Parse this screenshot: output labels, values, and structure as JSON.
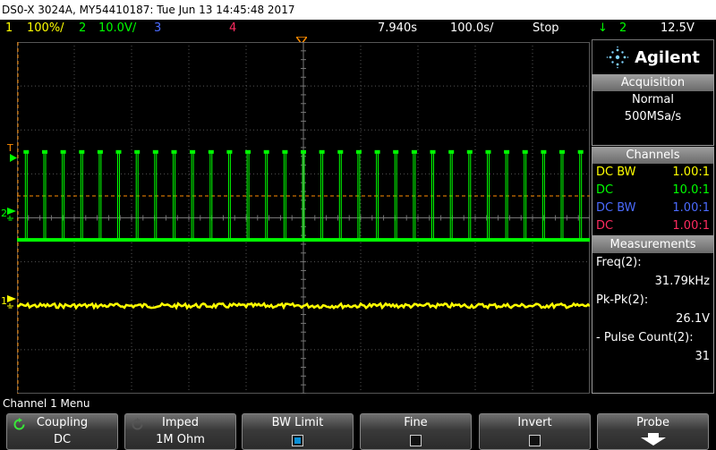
{
  "title_bar": {
    "text": "DS0-X 3024A, MY54410187: Tue Jun 13 14:45:48 2017"
  },
  "status_bar": {
    "ch1_num": "1",
    "ch1_scale": "100%/",
    "ch2_num": "2",
    "ch2_scale": "10.0V/",
    "ch3_num": "3",
    "ch4_num": "4",
    "time_delay": "7.940s",
    "time_scale": "100.0s/",
    "run_state": "Stop",
    "trigger_slope": "↓",
    "trigger_source": "2",
    "trigger_level": "12.5V"
  },
  "colors": {
    "ch1": "#ffff00",
    "ch2": "#00ff00",
    "ch3": "#4b6bff",
    "ch4": "#ff2b60",
    "trigger": "#ff8c00",
    "accent": "#0a8fd6"
  },
  "brand": {
    "name": "Agilent",
    "logo_icon": "spark-logo-icon"
  },
  "acquisition": {
    "header": "Acquisition",
    "mode": "Normal",
    "rate": "500MSa/s"
  },
  "channels": {
    "header": "Channels",
    "rows": [
      {
        "coupling": "DC BW",
        "value": "1.00:1",
        "color": "#ffff00"
      },
      {
        "coupling": "DC",
        "value": "10.0:1",
        "color": "#00ff00"
      },
      {
        "coupling": "DC BW",
        "value": "1.00:1",
        "color": "#4b6bff"
      },
      {
        "coupling": "DC",
        "value": "1.00:1",
        "color": "#ff2b60"
      }
    ]
  },
  "measurements": {
    "header": "Measurements",
    "items": [
      {
        "label": "Freq(2):",
        "value": "31.79kHz"
      },
      {
        "label": "Pk-Pk(2):",
        "value": "26.1V"
      },
      {
        "label": "- Pulse Count(2):",
        "value": "31"
      }
    ]
  },
  "markers": {
    "trigger": "T",
    "ch2": "2",
    "ch1": "1"
  },
  "menu_title": "Channel 1 Menu",
  "softkeys": [
    {
      "label": "Coupling",
      "value": "DC",
      "icon": "rotate-knob-icon"
    },
    {
      "label": "Imped",
      "value": "1M Ohm",
      "icon": "rotate-knob-icon"
    },
    {
      "label": "BW Limit",
      "checked": true
    },
    {
      "label": "Fine",
      "checked": false
    },
    {
      "label": "Invert",
      "checked": false
    },
    {
      "label": "Probe",
      "icon": "down-arrow-icon"
    }
  ],
  "waveform": {
    "ch2_pulse_count": 31,
    "ch2_baseline_div": -0.5,
    "ch2_high_div": 1.5,
    "ch1_level_div": -2.0,
    "trigger_level_div": 0.5
  }
}
